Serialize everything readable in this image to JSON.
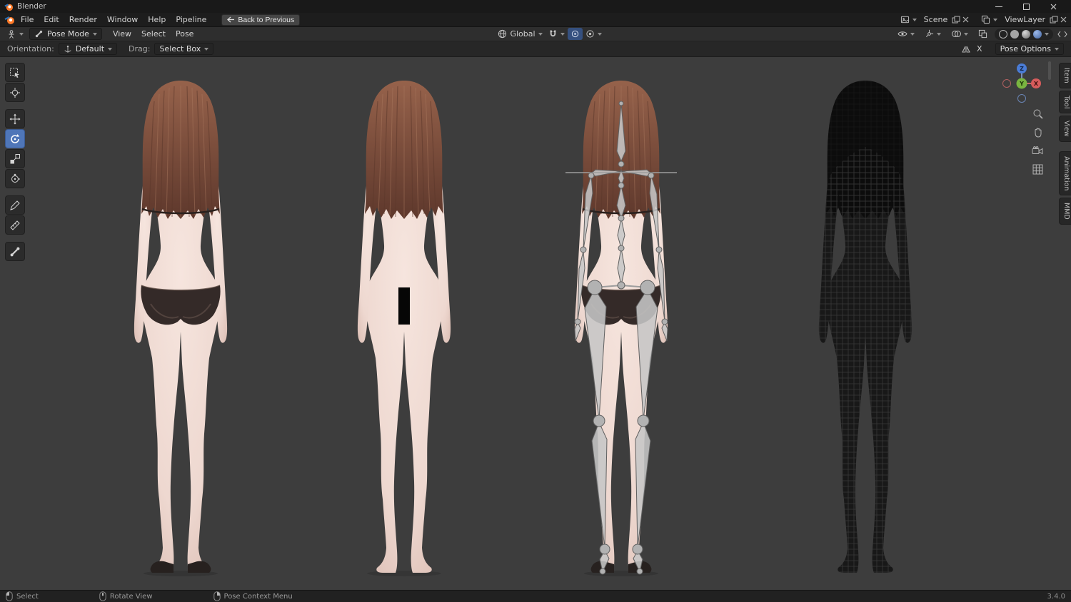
{
  "window": {
    "title": "Blender"
  },
  "menubar": {
    "menus": [
      "File",
      "Edit",
      "Render",
      "Window",
      "Help",
      "Pipeline"
    ],
    "back_button": "Back to Previous",
    "scene_selector": {
      "label": "Scene"
    },
    "viewlayer_selector": {
      "label": "ViewLayer"
    }
  },
  "viewport_header": {
    "mode_selector": "Pose Mode",
    "menus": [
      "View",
      "Select",
      "Pose"
    ],
    "transform_orientation": "Global"
  },
  "tool_settings": {
    "orientation_label": "Orientation:",
    "orientation_value": "Default",
    "drag_label": "Drag:",
    "drag_value": "Select Box",
    "mirror_x_label": "X",
    "pose_options_label": "Pose Options"
  },
  "toolbar_tools": [
    "select-box",
    "cursor",
    "move",
    "rotate",
    "scale",
    "transform",
    "annotate",
    "measure",
    "pose-breakdowner"
  ],
  "active_tool": "rotate",
  "gizmo_axes": {
    "x": "X",
    "y": "Y",
    "z": "Z"
  },
  "sidebar_tabs": [
    "Item",
    "Tool",
    "View",
    "Animation",
    "MMD"
  ],
  "status_bar": {
    "hints": [
      {
        "button": "left-mouse",
        "label": "Select"
      },
      {
        "button": "middle-mouse",
        "label": "Rotate View"
      },
      {
        "button": "right-mouse",
        "label": "Pose Context Menu"
      }
    ],
    "version": "3.4.0"
  },
  "viewport": {
    "figures": [
      "character-back-clothed",
      "character-back-censored",
      "character-back-armature",
      "character-back-wireframe"
    ]
  },
  "colors": {
    "accent_blue": "#4f76b8",
    "viewport_bg": "#3d3d3d",
    "header_bg": "#1d1d1d",
    "skin": "#eed8d0",
    "hair": "#7d4f3d",
    "bone_gray": "#c6c6c6",
    "axis_x_red": "#d65c5c",
    "axis_y_green": "#79b440",
    "axis_z_blue": "#4a7cd6"
  }
}
